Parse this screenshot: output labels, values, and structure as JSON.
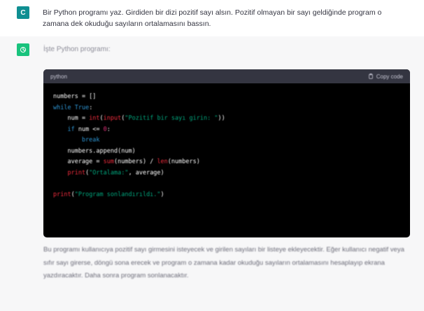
{
  "user_message": {
    "avatar_letter": "C",
    "text": "Bir Python programı yaz. Girdiden bir dizi pozitif sayı alsın. Pozitif olmayan bir sayı geldiğinde program o zamana dek okuduğu sayıların ortalamasını bassın."
  },
  "assistant_message": {
    "avatar_icon": "openai-logo-icon",
    "intro": "İşte Python programı:",
    "code_block": {
      "language": "python",
      "copy_label": "Copy code",
      "lines": [
        [
          {
            "t": "numbers = []",
            "c": "op"
          }
        ],
        [
          {
            "t": "while ",
            "c": "kw"
          },
          {
            "t": "True",
            "c": "kw"
          },
          {
            "t": ":",
            "c": "op"
          }
        ],
        [
          {
            "t": "    num = ",
            "c": "op"
          },
          {
            "t": "int",
            "c": "fn"
          },
          {
            "t": "(",
            "c": "op"
          },
          {
            "t": "input",
            "c": "fn"
          },
          {
            "t": "(",
            "c": "op"
          },
          {
            "t": "\"Pozitif bir sayı girin: \"",
            "c": "st"
          },
          {
            "t": "))",
            "c": "op"
          }
        ],
        [
          {
            "t": "    if ",
            "c": "kw"
          },
          {
            "t": "num <= ",
            "c": "op"
          },
          {
            "t": "0",
            "c": "nm"
          },
          {
            "t": ":",
            "c": "op"
          }
        ],
        [
          {
            "t": "        break",
            "c": "kw"
          }
        ],
        [
          {
            "t": "    numbers.append(num)",
            "c": "op"
          }
        ],
        [
          {
            "t": "    average = ",
            "c": "op"
          },
          {
            "t": "sum",
            "c": "fn"
          },
          {
            "t": "(numbers) / ",
            "c": "op"
          },
          {
            "t": "len",
            "c": "fn"
          },
          {
            "t": "(numbers)",
            "c": "op"
          }
        ],
        [
          {
            "t": "    print",
            "c": "fn"
          },
          {
            "t": "(",
            "c": "op"
          },
          {
            "t": "\"Ortalama:\"",
            "c": "st"
          },
          {
            "t": ", average)",
            "c": "op"
          }
        ],
        [
          {
            "t": "",
            "c": "op"
          }
        ],
        [
          {
            "t": "print",
            "c": "fn"
          },
          {
            "t": "(",
            "c": "op"
          },
          {
            "t": "\"Program sonlandırıldı.\"",
            "c": "st"
          },
          {
            "t": ")",
            "c": "op"
          }
        ]
      ]
    },
    "explanation": "Bu programı kullanıcıya pozitif sayı girmesini isteyecek ve girilen sayıları bir listeye ekleyecektir. Eğer kullanıcı negatif veya sıfır sayı girerse, döngü sona erecek ve program o zamana kadar okuduğu sayıların ortalamasını hesaplayıp ekrana yazdıracaktır. Daha sonra program sonlanacaktır."
  },
  "colors": {
    "user_avatar": "#0f8f92",
    "gpt_avatar": "#19c37d",
    "assistant_bg": "#f7f7f8",
    "code_bg": "#000000",
    "code_header_bg": "#343541"
  }
}
